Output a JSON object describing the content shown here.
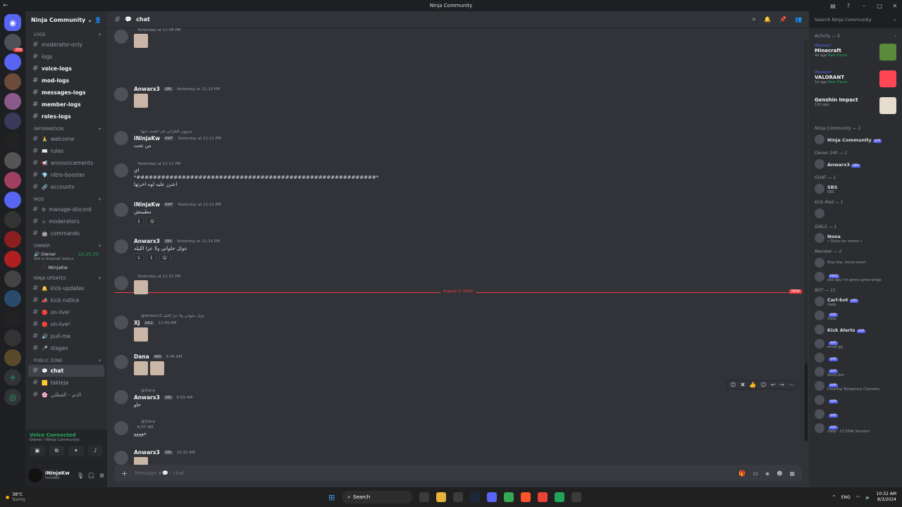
{
  "window": {
    "title": "Ninja Community"
  },
  "servers": {
    "home_badge": "169",
    "icons": 26
  },
  "guild": {
    "name": "Ninja Community"
  },
  "channels": {
    "cat_logs": "Logs",
    "logs": [
      "moderator-only",
      "logs",
      "voice-logs",
      "mod-logs",
      "messages-logs",
      "member-logs",
      "roles-logs"
    ],
    "cat_info": "INFORMATION",
    "info": [
      {
        "emo": "🙏",
        "name": "welcome"
      },
      {
        "emo": "📖",
        "name": "rules"
      },
      {
        "emo": "📢",
        "name": "announcements"
      },
      {
        "emo": "💎",
        "name": "nitro-booster"
      },
      {
        "emo": "🔗",
        "name": "accounts"
      }
    ],
    "cat_mod": "Mod",
    "mod": [
      {
        "emo": "⚙",
        "name": "manage-discord"
      },
      {
        "emo": "⚔",
        "name": "moderators"
      },
      {
        "emo": "🤖",
        "name": "commands"
      }
    ],
    "cat_owner": "Owner",
    "owner_voice": "Owner",
    "owner_time": "10:25:25",
    "owner_status": "Set a channel status",
    "owner_member": "iNinjaKw",
    "cat_updates": "NINJA UPDATES",
    "updates": [
      {
        "emo": "🔔",
        "name": "kick-updates"
      },
      {
        "emo": "📣",
        "name": "kick-notice"
      },
      {
        "emo": "🔴",
        "name": "on-live¹"
      },
      {
        "emo": "🔴",
        "name": "on-live²"
      },
      {
        "emo": "🔊",
        "name": "pull-me"
      },
      {
        "emo": "🎤",
        "name": "stages"
      }
    ],
    "cat_public": "PUBLIC ZONE",
    "public": [
      {
        "emo": "💬",
        "name": "chat"
      },
      {
        "emo": "🟨",
        "name": "takleja"
      },
      {
        "emo": "🌸",
        "name": "الدم - القطلي"
      }
    ]
  },
  "voice": {
    "status": "Voice Connected",
    "where": "Owner / Ninja Community"
  },
  "user": {
    "name": "iNinjaKw",
    "status": "Invisible"
  },
  "chat": {
    "channel": "chat",
    "placeholder": "Message #💬・chat",
    "messages": [
      {
        "author": "",
        "ts": "Yesterday at 11:08 PM",
        "text": "",
        "img": 1
      },
      {
        "author": "Anwarx3",
        "tag": "SBS",
        "ts": "Yesterday at 11:10 PM",
        "text": "",
        "img": 1
      },
      {
        "reply": "يعزوون الطرابي في انقسه دليها",
        "author": "iNinjaKw",
        "tag": "KWT",
        "ts": "Yesterday at 11:11 PM",
        "text": "من تحت"
      },
      {
        "author": "",
        "ts": "Yesterday at 11:11 PM",
        "text": "اي",
        "text2": "*##########################################################*",
        "text3": "اعترز عليه لوه اخرتها"
      },
      {
        "author": "iNinjaKw",
        "tag": "KWT",
        "ts": "Yesterday at 11:12 PM",
        "text": "مطيبتش",
        "reaction": "1"
      },
      {
        "author": "Anwarx3",
        "tag": "SBS",
        "ts": "Yesterday at 11:14 PM",
        "text": "عوثل حلواني ولا عزا الليله",
        "reaction": "1",
        "reaction2": "1"
      },
      {
        "author": "",
        "ts": "Yesterday at 11:37 PM",
        "text": "",
        "img": 1
      },
      {
        "reply": "@Anwarx3 عوثل حلواني ولا عزا الليله",
        "author": "XJ",
        "tag": "LVL1",
        "ts": "12:49 AM",
        "text": "",
        "img": 1
      },
      {
        "author": "Dana",
        "tag": "ABS",
        "ts": "6:46 AM",
        "text": "",
        "img": 2
      },
      {
        "reply": "@Dana",
        "author": "Anwarx3",
        "tag": "SBS",
        "ts": "6:59 AM",
        "text": "حلو"
      },
      {
        "reply": "@Dana",
        "author": "",
        "ts": "6:57 AM",
        "text": "خوووو"
      },
      {
        "author": "Anwarx3",
        "tag": "SBS",
        "ts": "10:32 AM",
        "text": "",
        "img": 1
      }
    ],
    "divider": "August 3, 2024",
    "new_label": "NEW"
  },
  "right": {
    "search_placeholder": "Search Ninja Community",
    "activity_header": "Activity — 5",
    "activities": [
      {
        "who": "Wazayef",
        "game": "Minecraft",
        "since": "4d ago",
        "extra": "New Player",
        "color": "#5b8b3a"
      },
      {
        "who": "Wazayef",
        "game": "VALORANT",
        "since": "1d ago",
        "extra": "New Player",
        "color": "#ff4655"
      },
      {
        "who": "",
        "game": "Genshin Impact",
        "since": "12h ago",
        "extra": "",
        "color": "#e6dccf"
      }
    ],
    "groups": [
      {
        "head": "Ninja Community — 1",
        "members": [
          {
            "name": "Ninja Community",
            "tag": "APP",
            "stat": ""
          }
        ]
      },
      {
        "head": "Owner 24h — 1",
        "members": [
          {
            "name": "Anwarx3",
            "tag": "SBS",
            "stat": ""
          }
        ]
      },
      {
        "head": "GOAT — 1",
        "members": [
          {
            "name": "SBS",
            "tag": "",
            "stat": "SBS"
          }
        ]
      },
      {
        "head": "Kick Mod — 1",
        "members": [
          {
            "name": "",
            "tag": "",
            "stat": ""
          }
        ]
      },
      {
        "head": "GIRLS — 1",
        "members": [
          {
            "name": "Nona",
            "tag": "",
            "stat": "• Dolce fer mente •"
          }
        ]
      },
      {
        "head": "Member — 2",
        "members": [
          {
            "name": "",
            "tag": "",
            "stat": "Stay low, move smart"
          },
          {
            "name": "",
            "tag": "PSYC",
            "stat": "one day i'm gonna grow wings"
          }
        ]
      },
      {
        "head": "BOT — 11",
        "members": [
          {
            "name": "Carl-bot",
            "tag": "APP",
            "stat": "/help"
          },
          {
            "name": "",
            "tag": "APP",
            "stat": "/help"
          },
          {
            "name": "Kick Alerts",
            "tag": "APP",
            "stat": ""
          },
          {
            "name": "",
            "tag": "APP",
            "stat": "emoji.gg"
          },
          {
            "name": "",
            "tag": "APP",
            "stat": ""
          },
          {
            "name": "",
            "tag": "APP",
            "stat": "wicks.bot"
          },
          {
            "name": "",
            "tag": "APP",
            "stat": "Creating Temporary Channels"
          },
          {
            "name": "",
            "tag": "APP",
            "stat": ""
          },
          {
            "name": "",
            "tag": "APP",
            "stat": ""
          },
          {
            "name": "",
            "tag": "APP",
            "stat": "/help - 27,509k Servers!"
          }
        ]
      }
    ]
  },
  "taskbar": {
    "weather": "38°C",
    "weather_sub": "Sunny",
    "search": "Search",
    "lang": "ENG",
    "time": "10:32 AM",
    "date": "8/3/2024"
  },
  "colors": {
    "accent": "#5865f2",
    "danger": "#f23f43",
    "online": "#23a559"
  }
}
